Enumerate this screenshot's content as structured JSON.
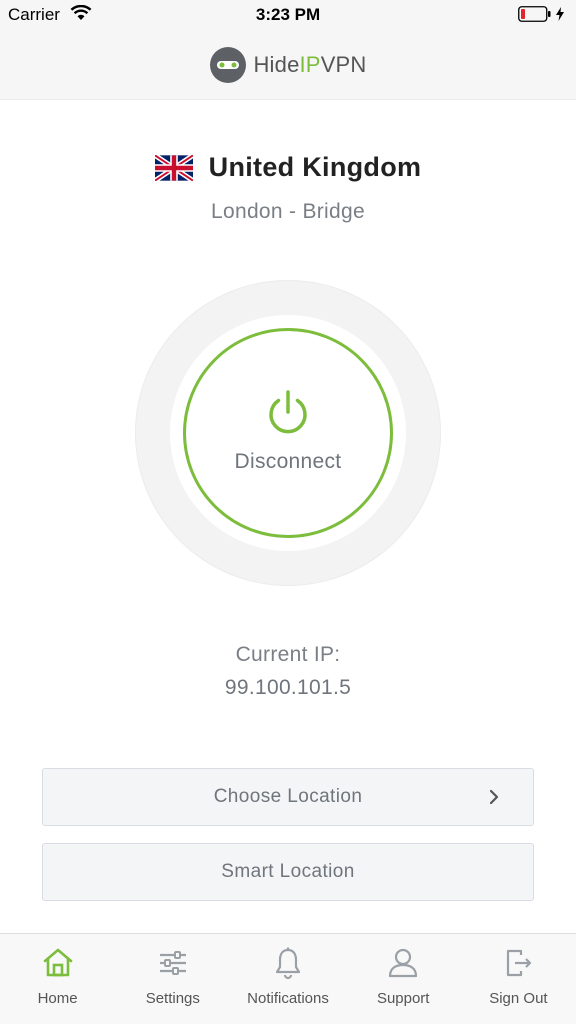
{
  "status_bar": {
    "carrier": "Carrier",
    "time": "3:23 PM"
  },
  "header": {
    "logo_text_part1": "Hide",
    "logo_text_accent": "IP",
    "logo_text_part2": "VPN"
  },
  "location": {
    "country": "United Kingdom",
    "city": "London - Bridge",
    "flag_icon": "uk-flag-icon"
  },
  "connection": {
    "action_label": "Disconnect",
    "accent_color": "#7cbd3c"
  },
  "ip": {
    "label": "Current IP:",
    "value": "99.100.101.5"
  },
  "buttons": {
    "choose_location": "Choose Location",
    "smart_location": "Smart Location"
  },
  "tabs": [
    {
      "label": "Home",
      "icon": "home-icon",
      "active": true
    },
    {
      "label": "Settings",
      "icon": "sliders-icon",
      "active": false
    },
    {
      "label": "Notifications",
      "icon": "bell-icon",
      "active": false
    },
    {
      "label": "Support",
      "icon": "user-icon",
      "active": false
    },
    {
      "label": "Sign Out",
      "icon": "sign-out-icon",
      "active": false
    }
  ]
}
